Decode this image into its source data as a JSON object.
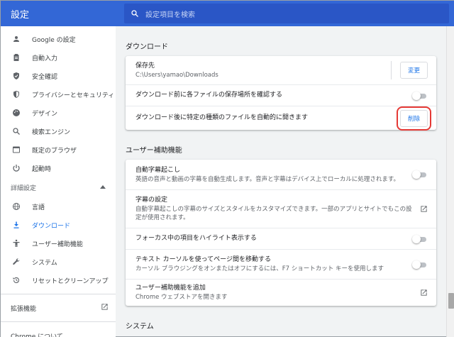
{
  "app": {
    "title": "設定"
  },
  "search": {
    "placeholder": "設定項目を検索"
  },
  "sidebar": {
    "items": [
      {
        "label": "Google の設定",
        "icon": "person-icon"
      },
      {
        "label": "自動入力",
        "icon": "clipboard-icon"
      },
      {
        "label": "安全確認",
        "icon": "shield-check-icon"
      },
      {
        "label": "プライバシーとセキュリティ",
        "icon": "shield-icon"
      },
      {
        "label": "デザイン",
        "icon": "palette-icon"
      },
      {
        "label": "検索エンジン",
        "icon": "search-icon"
      },
      {
        "label": "既定のブラウザ",
        "icon": "browser-icon"
      },
      {
        "label": "起動時",
        "icon": "power-icon"
      }
    ],
    "advanced_label": "詳細設定",
    "advanced_items": [
      {
        "label": "言語",
        "icon": "globe-icon"
      },
      {
        "label": "ダウンロード",
        "icon": "download-icon",
        "active": true
      },
      {
        "label": "ユーザー補助機能",
        "icon": "accessibility-icon"
      },
      {
        "label": "システム",
        "icon": "wrench-icon"
      },
      {
        "label": "リセットとクリーンアップ",
        "icon": "history-icon"
      }
    ],
    "extensions_label": "拡張機能",
    "about_label": "Chrome について"
  },
  "downloads": {
    "section_title": "ダウンロード",
    "location_label": "保存先",
    "location_path": "C:\\Users\\yamao\\Downloads",
    "change_button": "変更",
    "ask_location_label": "ダウンロード前に各ファイルの保存場所を確認する",
    "auto_open_label": "ダウンロード後に特定の種類のファイルを自動的に開きます",
    "clear_button": "削除"
  },
  "accessibility": {
    "section_title": "ユーザー補助機能",
    "live_caption_title": "自動字幕起こし",
    "live_caption_desc": "英語の音声と動画の字幕を自動生成します。音声と字幕はデバイス上でローカルに処理されます。",
    "caption_settings_title": "字幕の設定",
    "caption_settings_desc": "自動字幕起こしの字幕のサイズとスタイルをカスタマイズできます。一部のアプリとサイトでもこの設定が使用されます。",
    "focus_highlight_label": "フォーカス中の項目をハイライト表示する",
    "caret_browsing_title": "テキスト カーソルを使ってページ間を移動する",
    "caret_browsing_desc": "カーソル ブラウジングをオンまたはオフにするには、F7 ショートカット キーを使用します",
    "add_features_title": "ユーザー補助機能を追加",
    "add_features_desc": "Chrome ウェブストアを開きます"
  },
  "system": {
    "section_title": "システム"
  },
  "colors": {
    "accent": "#1a73e8",
    "topbar": "#3367d6",
    "highlight": "#e53935"
  }
}
